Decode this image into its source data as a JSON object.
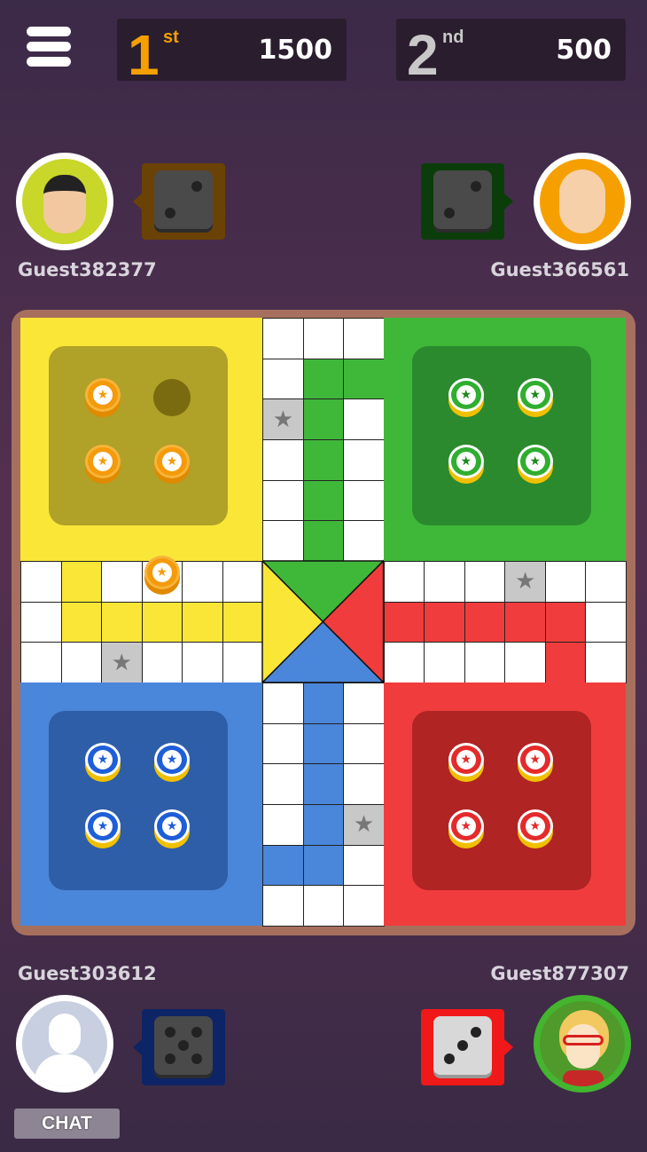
{
  "menu": {
    "icon": "hamburger-menu-icon"
  },
  "scores": [
    {
      "rank": "1",
      "suffix": "st",
      "points": "1500",
      "rank_color": "#f5a000"
    },
    {
      "rank": "2",
      "suffix": "nd",
      "points": "500",
      "rank_color": "#c8c8c8"
    }
  ],
  "players": {
    "yellow": {
      "name": "Guest382377",
      "dice_value": 2,
      "dice_box_color": "#6b4206",
      "avatar_ring": "#c9d62a"
    },
    "green": {
      "name": "Guest366561",
      "dice_value": 2,
      "dice_box_color": "#0b3d0b",
      "avatar_ring": "#f5a000"
    },
    "blue": {
      "name": "Guest303612",
      "dice_value": 5,
      "dice_box_color": "#0d2466",
      "avatar_ring": "#c7cfe0"
    },
    "red": {
      "name": "Guest877307",
      "dice_value": 3,
      "dice_box_color": "#f01818",
      "avatar_ring": "#43b52f",
      "active": true
    }
  },
  "colors": {
    "yellow": "#f9e637",
    "green": "#3fb83a",
    "blue": "#4a86d9",
    "red": "#f03c3c",
    "star_cell": "#c8c8c8"
  },
  "tokens": {
    "yellow_home": [
      true,
      false,
      true,
      true
    ],
    "green_home": [
      true,
      true,
      true,
      true
    ],
    "blue_home": [
      true,
      true,
      true,
      true
    ],
    "red_home": [
      true,
      true,
      true,
      true
    ],
    "yellow_on_track": [
      {
        "row": 6,
        "col": 3
      }
    ]
  },
  "chat": {
    "label": "CHAT"
  }
}
